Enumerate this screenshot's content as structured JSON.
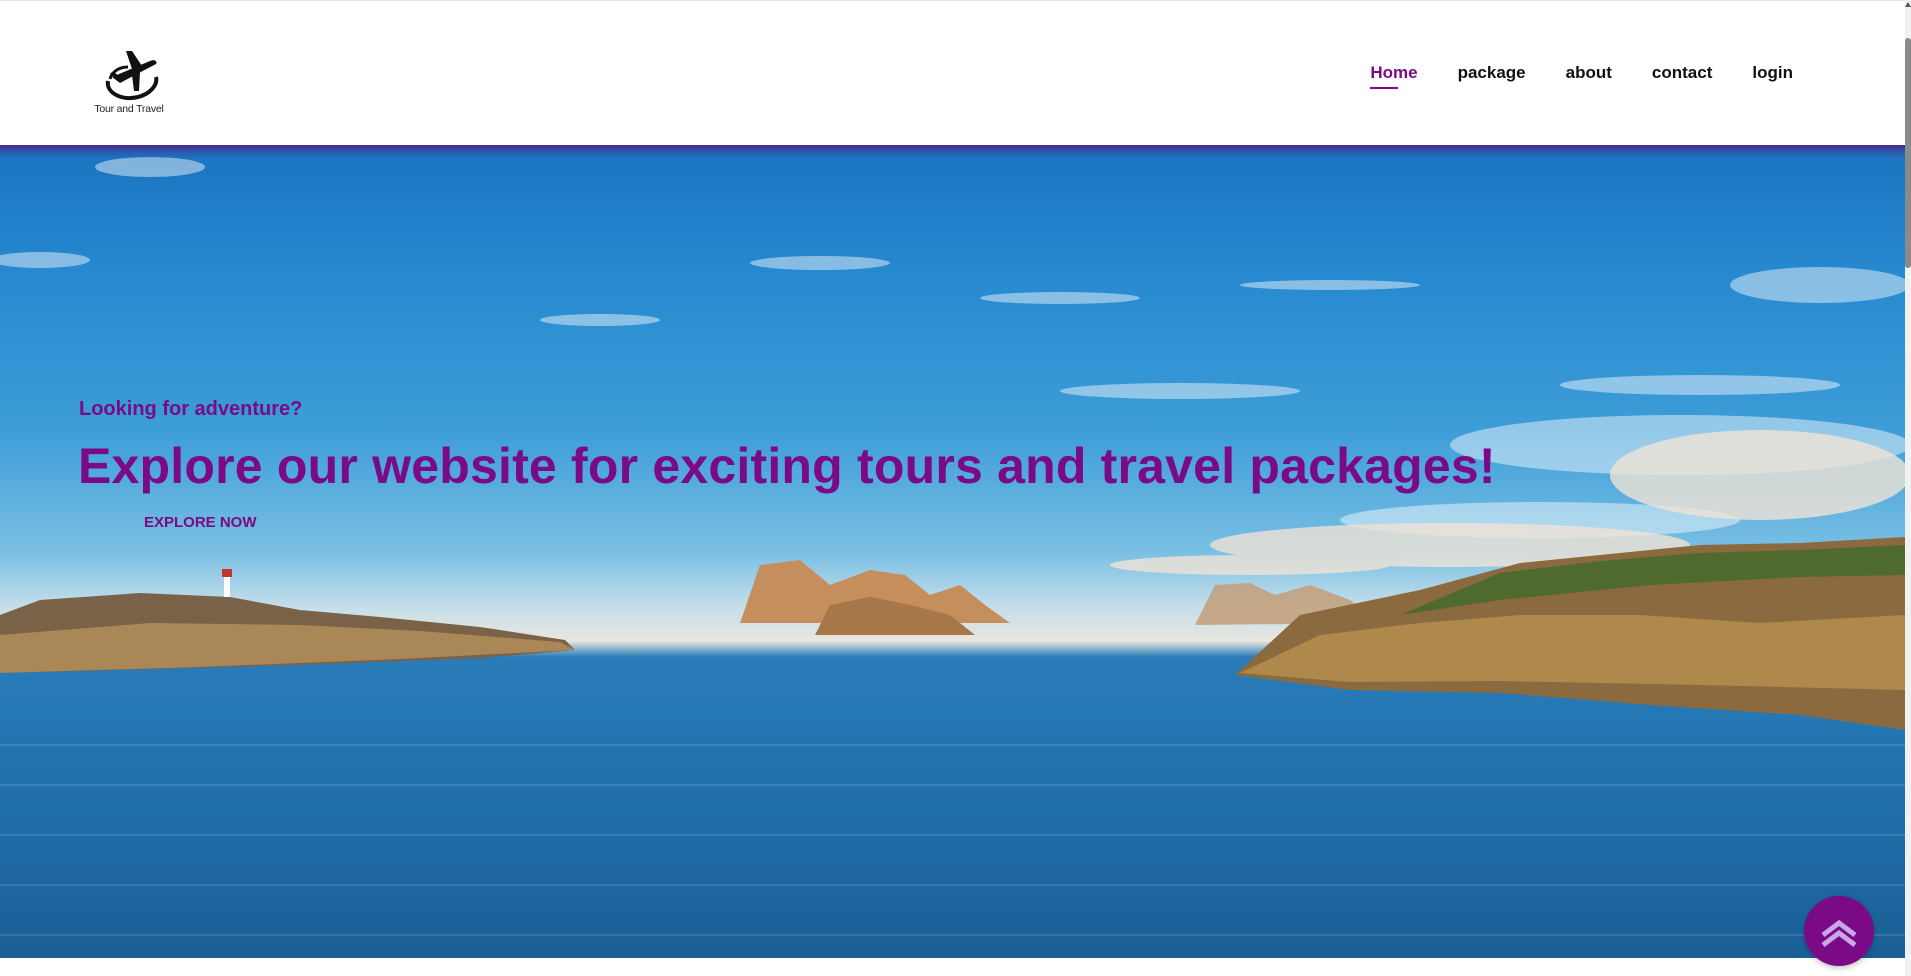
{
  "brand": {
    "logo_icon": "airplane-globe-icon",
    "logo_text": "Tour and Travel"
  },
  "nav": {
    "items": [
      {
        "label": "Home",
        "active": true
      },
      {
        "label": "package",
        "active": false
      },
      {
        "label": "about",
        "active": false
      },
      {
        "label": "contact",
        "active": false
      },
      {
        "label": "login",
        "active": false
      }
    ]
  },
  "hero": {
    "tagline": "Looking for adventure?",
    "headline": "Explore our website for exciting tours and travel packages!",
    "cta_label": "explore now"
  },
  "scroll_top": {
    "icon": "double-chevron-up-icon"
  },
  "colors": {
    "accent": "#7a0a85",
    "nav_text": "#111111",
    "header_bg": "#ffffff"
  }
}
